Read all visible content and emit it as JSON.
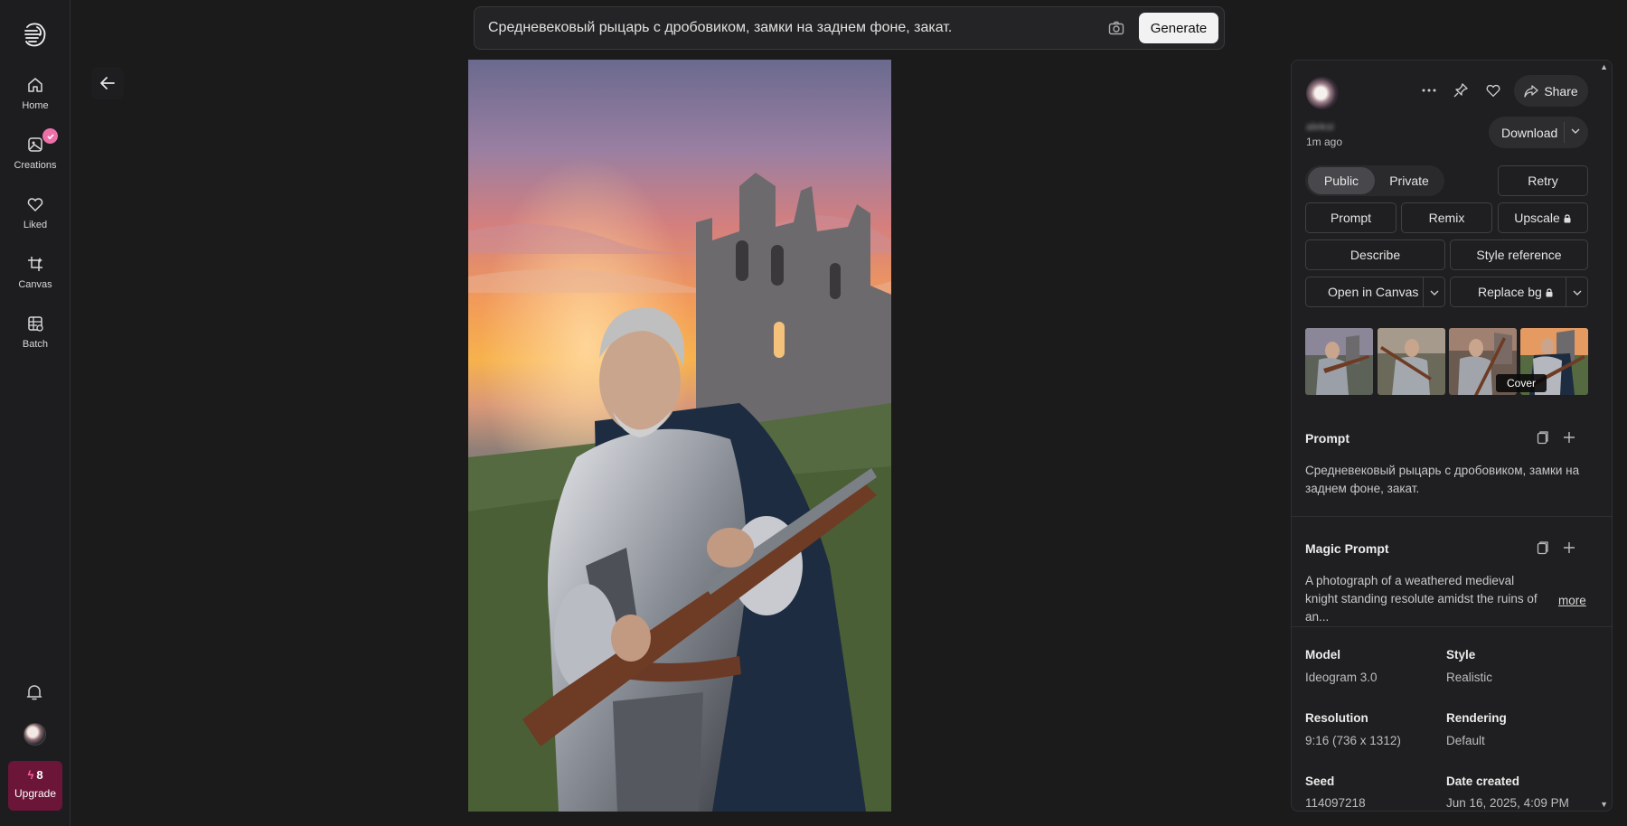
{
  "sidebar": {
    "items": [
      {
        "label": "Home",
        "icon": "home-icon"
      },
      {
        "label": "Creations",
        "icon": "image-icon"
      },
      {
        "label": "Liked",
        "icon": "heart-icon"
      },
      {
        "label": "Canvas",
        "icon": "canvas-icon"
      },
      {
        "label": "Batch",
        "icon": "batch-icon"
      }
    ],
    "credits": "8",
    "upgrade_label": "Upgrade"
  },
  "search": {
    "prompt_text": "Средневековый рыцарь с дробовиком, замки на заднем фоне, закат.",
    "generate_label": "Generate"
  },
  "panel": {
    "username": "aleksi",
    "time_ago": "1m ago",
    "share_label": "Share",
    "download_label": "Download",
    "visibility": {
      "public": "Public",
      "private": "Private",
      "selected": "Public"
    },
    "actions": {
      "retry": "Retry",
      "prompt": "Prompt",
      "remix": "Remix",
      "upscale": "Upscale",
      "describe": "Describe",
      "style_reference": "Style reference",
      "open_in_canvas": "Open in Canvas",
      "replace_bg": "Replace bg"
    },
    "cover_tooltip": "Cover",
    "prompt_section": {
      "title": "Prompt",
      "text": "Средневековый рыцарь с дробовиком, замки на заднем фоне, закат."
    },
    "magic_prompt_section": {
      "title": "Magic Prompt",
      "text": "A photograph of a weathered medieval knight standing resolute amidst the ruins of an...",
      "more_label": "more"
    },
    "meta": {
      "model_label": "Model",
      "model_value": "Ideogram 3.0",
      "style_label": "Style",
      "style_value": "Realistic",
      "resolution_label": "Resolution",
      "resolution_value": "9:16 (736 x 1312)",
      "rendering_label": "Rendering",
      "rendering_value": "Default",
      "seed_label": "Seed",
      "seed_value": "114097218",
      "date_label": "Date created",
      "date_value": "Jun 16, 2025, 4:09 PM"
    }
  },
  "colors": {
    "accent_pink": "#ee6fa8",
    "upgrade_bg": "#6b1539",
    "background": "#1b1b1c"
  }
}
